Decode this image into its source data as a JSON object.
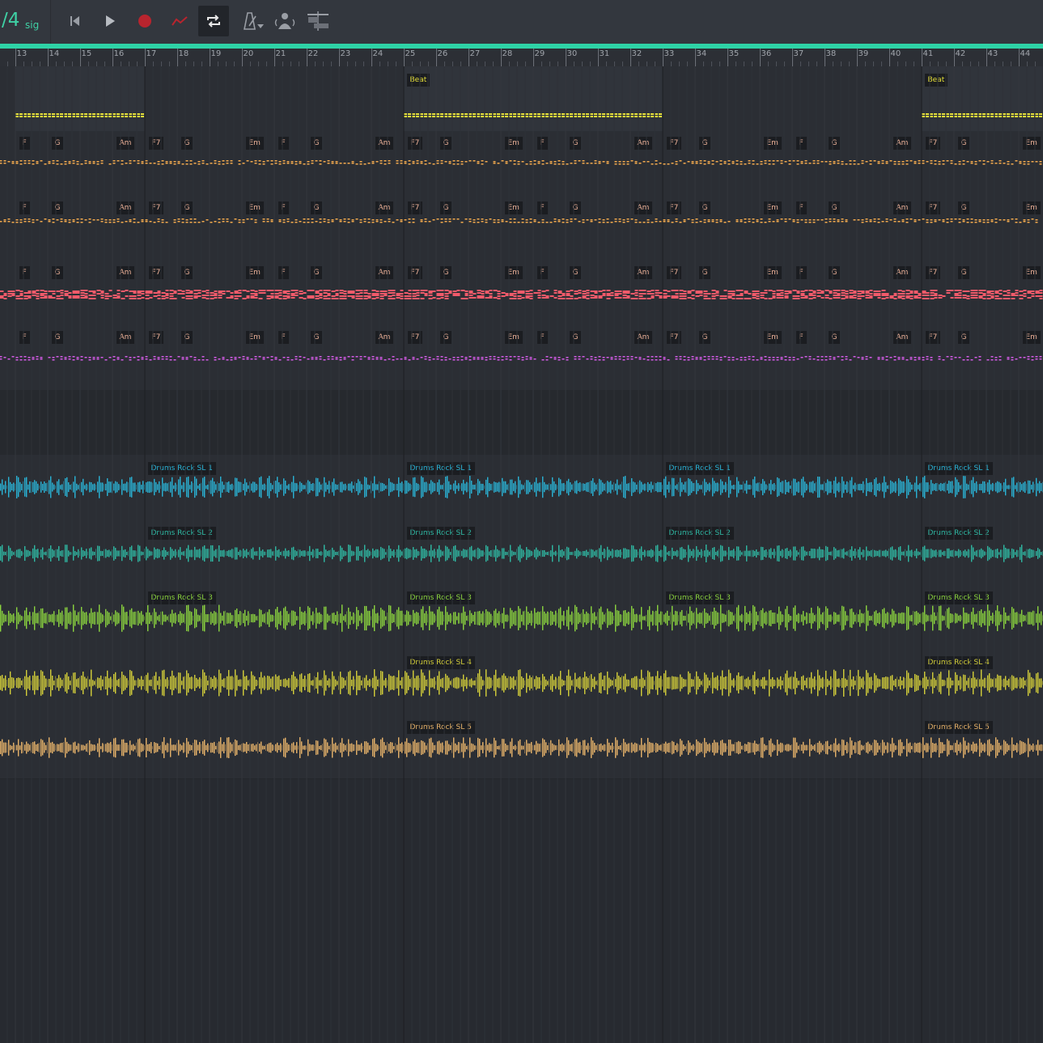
{
  "toolbar": {
    "time_signature": "/4",
    "sig_label": "sig",
    "buttons": [
      {
        "name": "skip-to-start-button",
        "icon": "skip-back-icon"
      },
      {
        "name": "play-button",
        "icon": "play-icon"
      },
      {
        "name": "record-button",
        "icon": "record-icon"
      },
      {
        "name": "automation-button",
        "icon": "automation-icon"
      },
      {
        "name": "loop-button",
        "icon": "loop-icon",
        "active": true
      },
      {
        "name": "metronome-button",
        "icon": "metronome-icon"
      },
      {
        "name": "count-in-button",
        "icon": "count-in-icon"
      },
      {
        "name": "punch-button",
        "icon": "punch-icon"
      }
    ]
  },
  "colors": {
    "accent": "#2ed3a6",
    "beat": "#e6e03a",
    "chords1": "#f2a94e",
    "chords2": "#f2a94e",
    "chords3": "#f05a6a",
    "chords4": "#d35be6",
    "drums1": "#2ab3d6",
    "drums2": "#2fb9a4",
    "drums3": "#8bd43f",
    "drums4": "#d4cf3a",
    "drums5": "#e8b36a"
  },
  "ruler": {
    "bars": [
      "13",
      "14",
      "15",
      "16",
      "17",
      "18",
      "19",
      "20",
      "21",
      "22",
      "23",
      "24",
      "25",
      "26",
      "27",
      "28",
      "29",
      "30",
      "31",
      "32",
      "33",
      "34",
      "35",
      "36",
      "37",
      "38",
      "39",
      "40",
      "41",
      "42",
      "43",
      "44"
    ]
  },
  "beat_track": {
    "clip_label": "Beat",
    "clip_bars": [
      25,
      41
    ]
  },
  "chord_tracks": {
    "progression": [
      "Em",
      "F",
      "G",
      "Am",
      "F7",
      "G"
    ]
  },
  "drum_tracks": [
    {
      "label": "Drums Rock SL 1",
      "clip_bars": [
        17,
        25,
        33,
        41
      ]
    },
    {
      "label": "Drums Rock SL 2",
      "clip_bars": [
        17,
        25,
        33,
        41
      ]
    },
    {
      "label": "Drums Rock SL 3",
      "clip_bars": [
        17,
        25,
        33,
        41
      ]
    },
    {
      "label": "Drums Rock SL 4",
      "clip_bars": [
        25,
        41
      ]
    },
    {
      "label": "Drums Rock SL 5",
      "clip_bars": [
        25,
        41
      ]
    }
  ]
}
